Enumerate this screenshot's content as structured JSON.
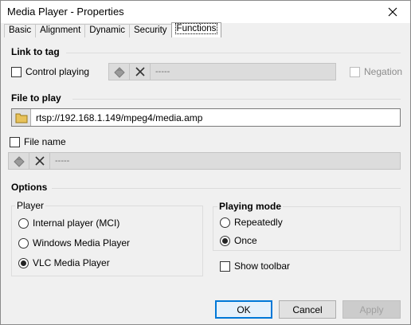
{
  "window": {
    "title": "Media Player - Properties"
  },
  "tabs": [
    {
      "label": "Basic",
      "active": false
    },
    {
      "label": "Alignment",
      "active": false
    },
    {
      "label": "Dynamic",
      "active": false
    },
    {
      "label": "Security",
      "active": false
    },
    {
      "label": "Functions",
      "active": true
    }
  ],
  "link_to_tag": {
    "title": "Link to tag",
    "control_playing_label": "Control playing",
    "control_playing_checked": false,
    "tag_value": "-----",
    "negation_label": "Negation",
    "negation_checked": false
  },
  "file_to_play": {
    "title": "File to play",
    "path": "rtsp://192.168.1.149/mpeg4/media.amp",
    "file_name_label": "File name",
    "file_name_checked": false,
    "tag_value": "-----"
  },
  "options": {
    "title": "Options",
    "player": {
      "label": "Player",
      "choices": [
        "Internal player (MCI)",
        "Windows Media Player",
        "VLC Media Player"
      ],
      "selected": "VLC Media Player"
    },
    "playing_mode": {
      "label": "Playing mode",
      "choices": [
        "Repeatedly",
        "Once"
      ],
      "selected": "Once"
    },
    "show_toolbar_label": "Show toolbar",
    "show_toolbar_checked": false
  },
  "buttons": {
    "ok": "OK",
    "cancel": "Cancel",
    "apply": "Apply"
  },
  "colors": {
    "accent": "#0078d7",
    "dialog_bg": "#f0f0f0",
    "disabled_text": "#8c8c8c"
  }
}
